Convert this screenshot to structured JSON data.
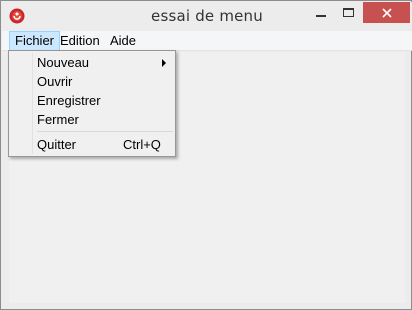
{
  "window": {
    "title": "essai de menu",
    "accent_close": "#c75050",
    "icons": {
      "app": "app-icon",
      "minimize": "minimize-icon",
      "maximize": "maximize-icon",
      "close": "close-icon"
    }
  },
  "menubar": {
    "items": [
      {
        "label": "Fichier",
        "active": true
      },
      {
        "label": "Edition",
        "active": false
      },
      {
        "label": "Aide",
        "active": false
      }
    ]
  },
  "dropdown": {
    "items": [
      {
        "label": "Nouveau",
        "submenu": true,
        "shortcut": ""
      },
      {
        "label": "Ouvrir",
        "submenu": false,
        "shortcut": ""
      },
      {
        "label": "Enregistrer",
        "submenu": false,
        "shortcut": ""
      },
      {
        "label": "Fermer",
        "submenu": false,
        "shortcut": ""
      },
      {
        "label": "Quitter",
        "submenu": false,
        "shortcut": "Ctrl+Q"
      }
    ]
  }
}
